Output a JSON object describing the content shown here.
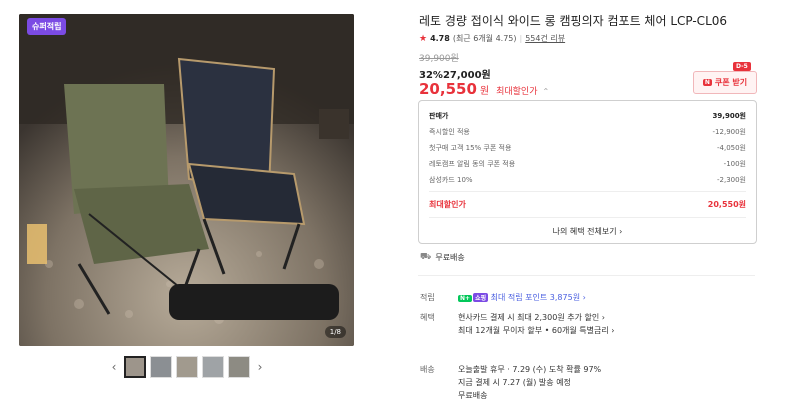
{
  "image": {
    "badge": "슈퍼적립",
    "pager": "1/8",
    "thumbs_count": 5
  },
  "product": {
    "title": "레토 경량 접이식 와이드 롱 캠핑의자 컴포트 체어 LCP-CL06",
    "rating": "4.78",
    "rating_recent": "(최근 6개월 4.75)",
    "reviews": "554건 리뷰",
    "original_price": "39,900원",
    "discount": "32%",
    "discount_price": "27,000원",
    "final_price": "20,550",
    "final_unit": "원",
    "final_label": "최대할인가"
  },
  "coupon": {
    "dday": "D-5",
    "label": "쿠폰 받기",
    "n": "N"
  },
  "breakdown": {
    "rows": [
      {
        "label": "판매가",
        "value": "39,900원"
      },
      {
        "label": "즉시할인 적용",
        "value": "-12,900원"
      },
      {
        "label": "첫구매 고객 15% 쿠폰 적용",
        "value": "-4,050원"
      },
      {
        "label": "레토캠프 알림 동의 쿠폰 적용",
        "value": "-100원"
      },
      {
        "label": "삼성카드 10%",
        "value": "-2,300원"
      }
    ],
    "total_label": "최대할인가",
    "total_value": "20,550원",
    "more_label": "나의 혜택 전체보기 ›"
  },
  "shipping_free": "무료배송",
  "points": {
    "label": "적립",
    "tag1": "N+",
    "tag2": "쇼핑",
    "text": "최대 적립 포인트 3,875원 ›"
  },
  "benefits": {
    "label": "혜택",
    "line1": "현사카드 결제 시 최대 2,300원 추가 할인 ›",
    "line2": "최대 12개월 무이자 할부 • 60개월 특별금리 ›"
  },
  "delivery": {
    "label": "배송",
    "line1": "오늘출발 휴무 · 7.29 (수) 도착 확률 97%",
    "line2": "지금 결제 시 7.27 (월) 발송 예정",
    "line3": "무료배송"
  }
}
